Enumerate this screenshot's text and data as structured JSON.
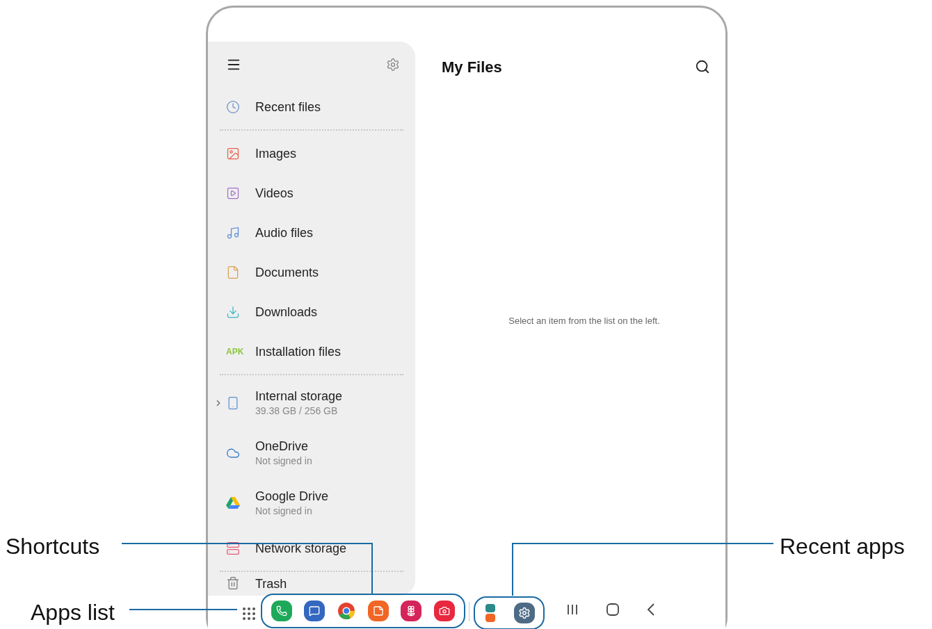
{
  "callouts": [
    {
      "text": "Shortcuts"
    },
    {
      "text": "Apps list"
    },
    {
      "text": "Recent apps"
    }
  ],
  "sidebar": {
    "sections": [
      [
        {
          "label": "Recent files"
        }
      ],
      [
        {
          "label": "Images"
        },
        {
          "label": "Videos"
        },
        {
          "label": "Audio files"
        },
        {
          "label": "Documents"
        },
        {
          "label": "Downloads"
        },
        {
          "label": "Installation files",
          "badge": "APK"
        }
      ],
      [
        {
          "label": "Internal storage",
          "sublabel": "39.38 GB / 256 GB",
          "expanded": false
        },
        {
          "label": "OneDrive",
          "sublabel": "Not signed in"
        },
        {
          "label": "Google Drive",
          "sublabel": "Not signed in"
        },
        {
          "label": "Network storage"
        }
      ],
      [
        {
          "label": "Trash"
        }
      ]
    ]
  },
  "main": {
    "title": "My Files",
    "empty_message": "Select an item from the list on the left."
  }
}
